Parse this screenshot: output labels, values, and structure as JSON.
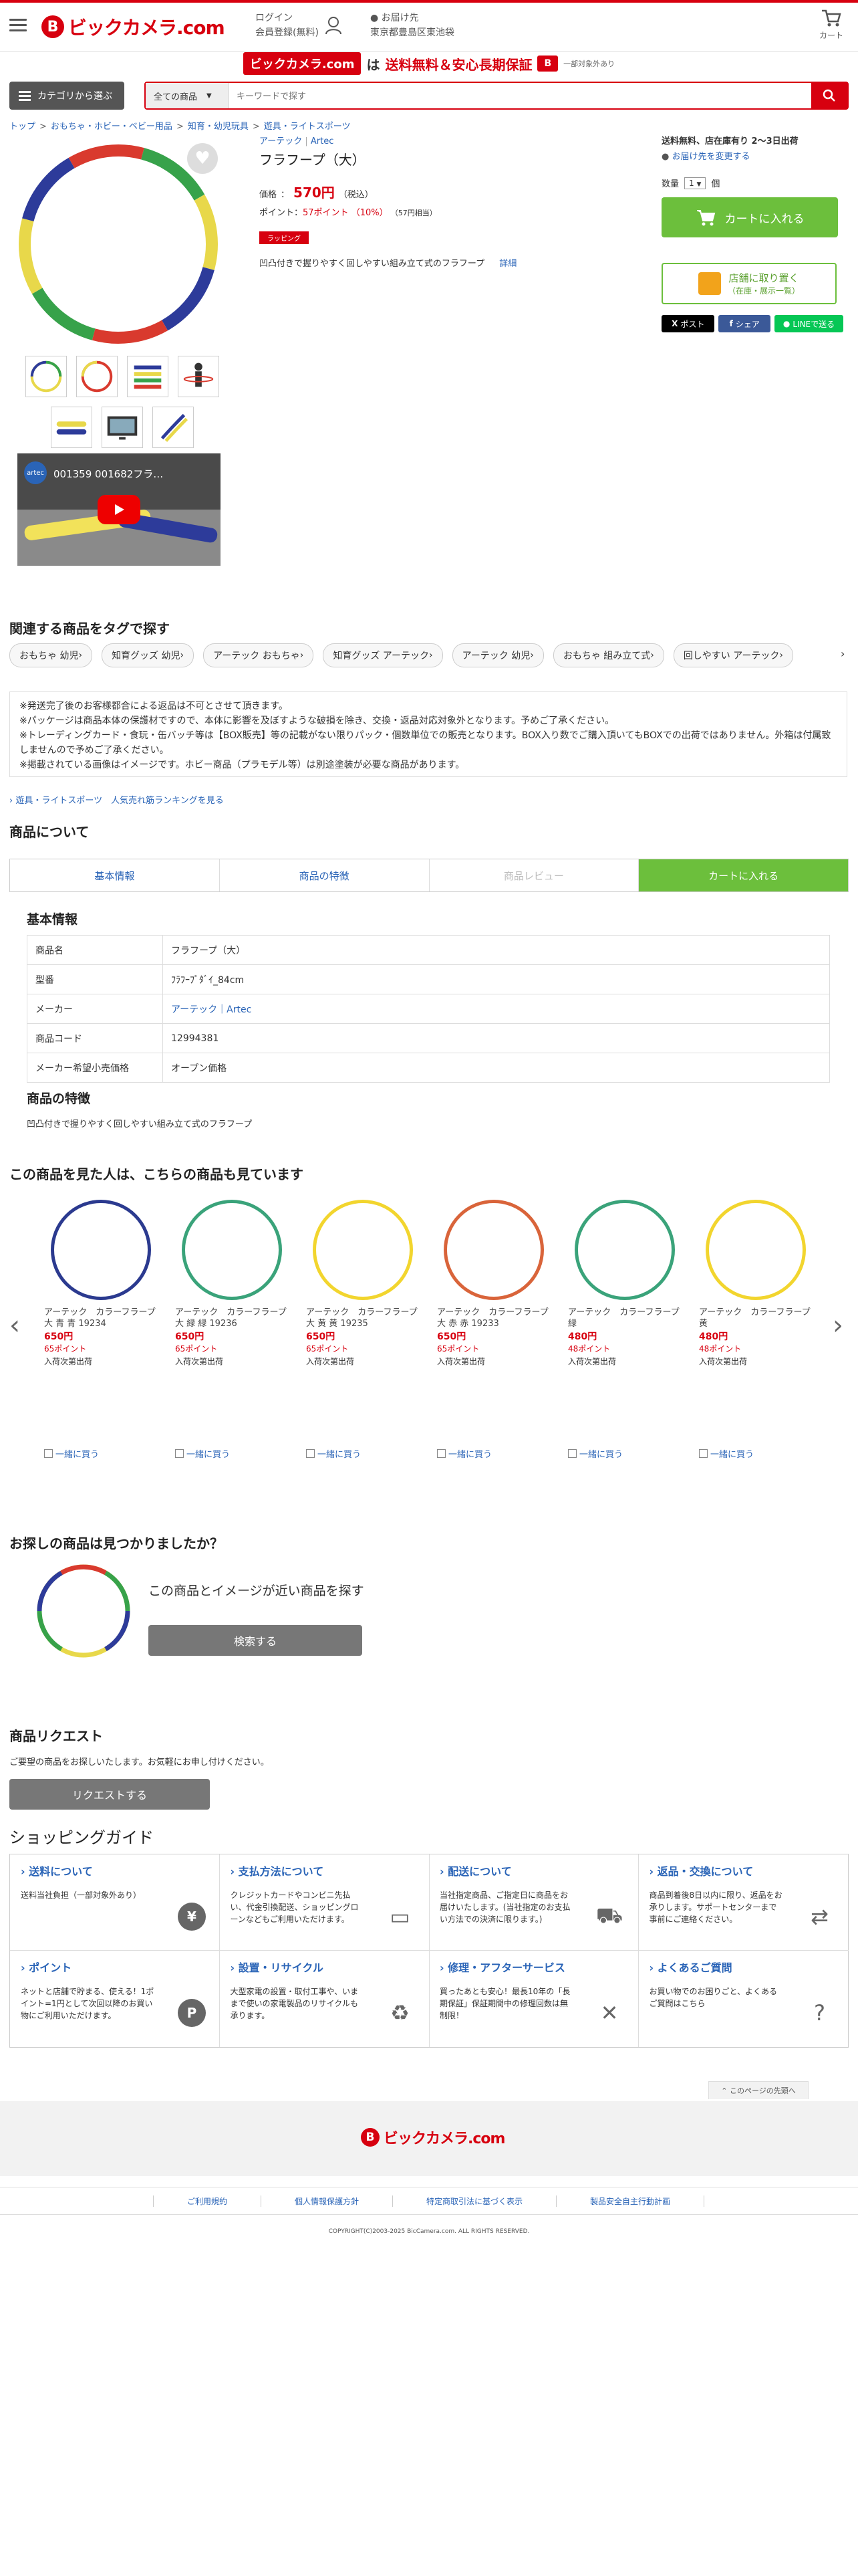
{
  "header": {
    "logo_text": "ビックカメラ.com",
    "login": "ログイン",
    "register": "会員登録(無料)",
    "delivery_label": "お届け先",
    "delivery_address": "東京都豊島区東池袋",
    "cart_label": "カート"
  },
  "banner": {
    "logo": "ビックカメラ.com",
    "wa": "は",
    "main": "送料無料＆安心長期保証",
    "note": "一部対象外あり"
  },
  "search": {
    "category_button": "カテゴリから選ぶ",
    "scope": "全ての商品",
    "placeholder": "キーワードで探す"
  },
  "breadcrumb": [
    "トップ",
    ">",
    "おもちゃ・ホビー・ベビー用品",
    ">",
    "知育・幼児玩具",
    ">",
    "遊具・ライトスポーツ"
  ],
  "product": {
    "maker": "アーテック",
    "maker_sep": "|",
    "maker_en": "Artec",
    "title": "フラフープ（大）",
    "price_label": "価格",
    "price_colon": "：",
    "price": "570円",
    "tax": "（税込）",
    "point_label": "ポイント：",
    "point_value": "57ポイント",
    "point_pct": "（10%）",
    "point_note": "（57円相当）",
    "wrapping_badge": "ラッピング",
    "description": "凹凸付きで握りやすく回しやすい組み立て式のフラフープ",
    "detail_link": "詳細",
    "video_title": "001359 001682フラ…"
  },
  "buybox": {
    "shipping": "送料無料、店在庫有り 2～3日出荷",
    "change_address": "お届け先を変更する",
    "qty_label": "数量",
    "qty_value": "1",
    "qty_unit": "個",
    "cart_button": "カートに入れる",
    "store_pickup": "店舗に取り置く",
    "store_sub": "（在庫・展示一覧）",
    "share_x": "ポスト",
    "share_fb": "シェア",
    "share_line": "LINEで送る"
  },
  "tags": {
    "heading": "関連する商品をタグで探す",
    "items": [
      "おもちゃ 幼児",
      "知育グッズ 幼児",
      "アーテック おもちゃ",
      "知育グッズ アーテック",
      "アーテック 幼児",
      "おもちゃ 組み立て式",
      "回しやすい アーテック"
    ]
  },
  "notice": {
    "lines": [
      "※発送完了後のお客様都合による返品は不可とさせて頂きます。",
      "※パッケージは商品本体の保護材ですので、本体に影響を及ぼすような破損を除き、交換・返品対応対象外となります。予めご了承ください。",
      "※トレーディングカード・食玩・缶バッチ等は【BOX販売】等の記載がない限りパック・個数単位での販売となります。BOX入り数でご購入頂いてもBOXでの出荷ではありません。外箱は付属致しませんので予めご了承ください。",
      "※掲載されている画像はイメージです。ホビー商品（プラモデル等）は別途塗装が必要な商品があります。"
    ]
  },
  "ranking_link": "遊具・ライトスポーツ　人気売れ筋ランキングを見る",
  "about": {
    "heading": "商品について",
    "tabs": [
      "基本情報",
      "商品の特徴",
      "商品レビュー",
      "カートに入れる"
    ]
  },
  "basic_info": {
    "heading": "基本情報",
    "rows": [
      {
        "k": "商品名",
        "v": "フラフープ（大）"
      },
      {
        "k": "型番",
        "v": "ﾌﾗﾌｰﾌﾟﾀﾞｲ_84cm"
      },
      {
        "k": "メーカー",
        "v": "アーテック｜Artec"
      },
      {
        "k": "商品コード",
        "v": "12994381"
      },
      {
        "k": "メーカー希望小売価格",
        "v": "オープン価格"
      }
    ]
  },
  "features": {
    "heading": "商品の特徴",
    "text": "凹凸付きで握りやすく回しやすい組み立て式のフラフープ"
  },
  "also_viewed": {
    "heading": "この商品を見た人は、こちらの商品も見ています",
    "items": [
      {
        "name1": "アーテック　カラーフラープ",
        "name2": "大 青 青 19234",
        "price": "650円",
        "points": "65ポイント",
        "stock": "入荷次第出荷",
        "check": "一緒に買う",
        "color": "#2b3a8f"
      },
      {
        "name1": "アーテック　カラーフラープ",
        "name2": "大 緑 緑 19236",
        "price": "650円",
        "points": "65ポイント",
        "stock": "入荷次第出荷",
        "check": "一緒に買う",
        "color": "#3aa37a"
      },
      {
        "name1": "アーテック　カラーフラープ",
        "name2": "大 黄 黄 19235",
        "price": "650円",
        "points": "65ポイント",
        "stock": "入荷次第出荷",
        "check": "一緒に買う",
        "color": "#f2d52e"
      },
      {
        "name1": "アーテック　カラーフラープ",
        "name2": "大 赤 赤 19233",
        "price": "650円",
        "points": "65ポイント",
        "stock": "入荷次第出荷",
        "check": "一緒に買う",
        "color": "#d9643a"
      },
      {
        "name1": "アーテック　カラーフラープ",
        "name2": "緑",
        "price": "480円",
        "points": "48ポイント",
        "stock": "入荷次第出荷",
        "check": "一緒に買う",
        "color": "#3aa37a"
      },
      {
        "name1": "アーテック　カラーフラープ",
        "name2": "黄",
        "price": "480円",
        "points": "48ポイント",
        "stock": "入荷次第出荷",
        "check": "一緒に買う",
        "color": "#f2d52e"
      }
    ]
  },
  "find": {
    "heading": "お探しの商品は見つかりましたか？",
    "similar_text": "この商品とイメージが近い商品を探す",
    "search_button": "検索する"
  },
  "request": {
    "heading": "商品リクエスト",
    "text": "ご要望の商品をお探しいたします。お気軽にお申し付けください。",
    "button": "リクエストする"
  },
  "guide": {
    "heading": "ショッピングガイド",
    "cells": [
      {
        "title": "送料について",
        "desc": "送料当社負担（一部対象外あり）",
        "icon": "yen-icon"
      },
      {
        "title": "支払方法について",
        "desc": "クレジットカードやコンビニ先払い、代金引換配送、ショッピングローンなどもご利用いただけます。",
        "icon": "card-icon"
      },
      {
        "title": "配送について",
        "desc": "当社指定商品、ご指定日に商品をお届けいたします。(当社指定のお支払い方法での決済に限ります。)",
        "icon": "truck-icon"
      },
      {
        "title": "返品・交換について",
        "desc": "商品到着後8日以内に限り、返品をお承りします。サポートセンターまで事前にご連絡ください。",
        "icon": "exchange-icon"
      },
      {
        "title": "ポイント",
        "desc": "ネットと店舗で貯まる、使える！1ポイント=1円として次回以降のお買い物にご利用いただけます。",
        "icon": "point-icon"
      },
      {
        "title": "設置・リサイクル",
        "desc": "大型家電の設置・取付工事や、いままで使いの家電製品のリサイクルも承ります。",
        "icon": "recycle-icon"
      },
      {
        "title": "修理・アフターサービス",
        "desc": "買ったあとも安心！最長10年の「長期保証」保証期間中の修理回数は無制限！",
        "icon": "tools-icon"
      },
      {
        "title": "よくあるご質問",
        "desc": "お買い物でのお困りごと、よくあるご質問はこちら",
        "icon": "qa-icon"
      }
    ]
  },
  "page_top": "このページの先頭へ",
  "footer": {
    "logo": "ビックカメラ.com",
    "links": [
      "ご利用規約",
      "個人情報保護方針",
      "特定商取引法に基づく表示",
      "製品安全自主行動計画"
    ],
    "copyright": "COPYRIGHT(C)2003-2025 BicCamera.com. ALL RIGHTS RESERVED."
  }
}
